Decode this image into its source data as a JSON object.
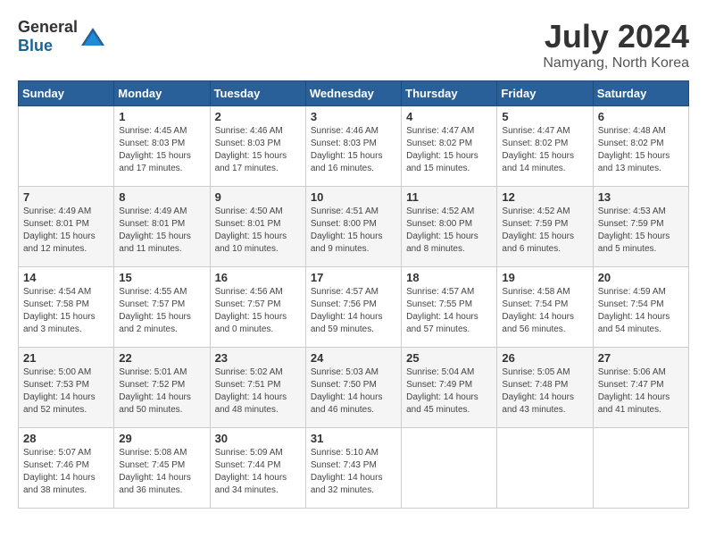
{
  "header": {
    "logo_general": "General",
    "logo_blue": "Blue",
    "month_title": "July 2024",
    "location": "Namyang, North Korea"
  },
  "calendar": {
    "days_of_week": [
      "Sunday",
      "Monday",
      "Tuesday",
      "Wednesday",
      "Thursday",
      "Friday",
      "Saturday"
    ],
    "weeks": [
      [
        {
          "day": "",
          "info": ""
        },
        {
          "day": "1",
          "info": "Sunrise: 4:45 AM\nSunset: 8:03 PM\nDaylight: 15 hours\nand 17 minutes."
        },
        {
          "day": "2",
          "info": "Sunrise: 4:46 AM\nSunset: 8:03 PM\nDaylight: 15 hours\nand 17 minutes."
        },
        {
          "day": "3",
          "info": "Sunrise: 4:46 AM\nSunset: 8:03 PM\nDaylight: 15 hours\nand 16 minutes."
        },
        {
          "day": "4",
          "info": "Sunrise: 4:47 AM\nSunset: 8:02 PM\nDaylight: 15 hours\nand 15 minutes."
        },
        {
          "day": "5",
          "info": "Sunrise: 4:47 AM\nSunset: 8:02 PM\nDaylight: 15 hours\nand 14 minutes."
        },
        {
          "day": "6",
          "info": "Sunrise: 4:48 AM\nSunset: 8:02 PM\nDaylight: 15 hours\nand 13 minutes."
        }
      ],
      [
        {
          "day": "7",
          "info": "Sunrise: 4:49 AM\nSunset: 8:01 PM\nDaylight: 15 hours\nand 12 minutes."
        },
        {
          "day": "8",
          "info": "Sunrise: 4:49 AM\nSunset: 8:01 PM\nDaylight: 15 hours\nand 11 minutes."
        },
        {
          "day": "9",
          "info": "Sunrise: 4:50 AM\nSunset: 8:01 PM\nDaylight: 15 hours\nand 10 minutes."
        },
        {
          "day": "10",
          "info": "Sunrise: 4:51 AM\nSunset: 8:00 PM\nDaylight: 15 hours\nand 9 minutes."
        },
        {
          "day": "11",
          "info": "Sunrise: 4:52 AM\nSunset: 8:00 PM\nDaylight: 15 hours\nand 8 minutes."
        },
        {
          "day": "12",
          "info": "Sunrise: 4:52 AM\nSunset: 7:59 PM\nDaylight: 15 hours\nand 6 minutes."
        },
        {
          "day": "13",
          "info": "Sunrise: 4:53 AM\nSunset: 7:59 PM\nDaylight: 15 hours\nand 5 minutes."
        }
      ],
      [
        {
          "day": "14",
          "info": "Sunrise: 4:54 AM\nSunset: 7:58 PM\nDaylight: 15 hours\nand 3 minutes."
        },
        {
          "day": "15",
          "info": "Sunrise: 4:55 AM\nSunset: 7:57 PM\nDaylight: 15 hours\nand 2 minutes."
        },
        {
          "day": "16",
          "info": "Sunrise: 4:56 AM\nSunset: 7:57 PM\nDaylight: 15 hours\nand 0 minutes."
        },
        {
          "day": "17",
          "info": "Sunrise: 4:57 AM\nSunset: 7:56 PM\nDaylight: 14 hours\nand 59 minutes."
        },
        {
          "day": "18",
          "info": "Sunrise: 4:57 AM\nSunset: 7:55 PM\nDaylight: 14 hours\nand 57 minutes."
        },
        {
          "day": "19",
          "info": "Sunrise: 4:58 AM\nSunset: 7:54 PM\nDaylight: 14 hours\nand 56 minutes."
        },
        {
          "day": "20",
          "info": "Sunrise: 4:59 AM\nSunset: 7:54 PM\nDaylight: 14 hours\nand 54 minutes."
        }
      ],
      [
        {
          "day": "21",
          "info": "Sunrise: 5:00 AM\nSunset: 7:53 PM\nDaylight: 14 hours\nand 52 minutes."
        },
        {
          "day": "22",
          "info": "Sunrise: 5:01 AM\nSunset: 7:52 PM\nDaylight: 14 hours\nand 50 minutes."
        },
        {
          "day": "23",
          "info": "Sunrise: 5:02 AM\nSunset: 7:51 PM\nDaylight: 14 hours\nand 48 minutes."
        },
        {
          "day": "24",
          "info": "Sunrise: 5:03 AM\nSunset: 7:50 PM\nDaylight: 14 hours\nand 46 minutes."
        },
        {
          "day": "25",
          "info": "Sunrise: 5:04 AM\nSunset: 7:49 PM\nDaylight: 14 hours\nand 45 minutes."
        },
        {
          "day": "26",
          "info": "Sunrise: 5:05 AM\nSunset: 7:48 PM\nDaylight: 14 hours\nand 43 minutes."
        },
        {
          "day": "27",
          "info": "Sunrise: 5:06 AM\nSunset: 7:47 PM\nDaylight: 14 hours\nand 41 minutes."
        }
      ],
      [
        {
          "day": "28",
          "info": "Sunrise: 5:07 AM\nSunset: 7:46 PM\nDaylight: 14 hours\nand 38 minutes."
        },
        {
          "day": "29",
          "info": "Sunrise: 5:08 AM\nSunset: 7:45 PM\nDaylight: 14 hours\nand 36 minutes."
        },
        {
          "day": "30",
          "info": "Sunrise: 5:09 AM\nSunset: 7:44 PM\nDaylight: 14 hours\nand 34 minutes."
        },
        {
          "day": "31",
          "info": "Sunrise: 5:10 AM\nSunset: 7:43 PM\nDaylight: 14 hours\nand 32 minutes."
        },
        {
          "day": "",
          "info": ""
        },
        {
          "day": "",
          "info": ""
        },
        {
          "day": "",
          "info": ""
        }
      ]
    ]
  }
}
